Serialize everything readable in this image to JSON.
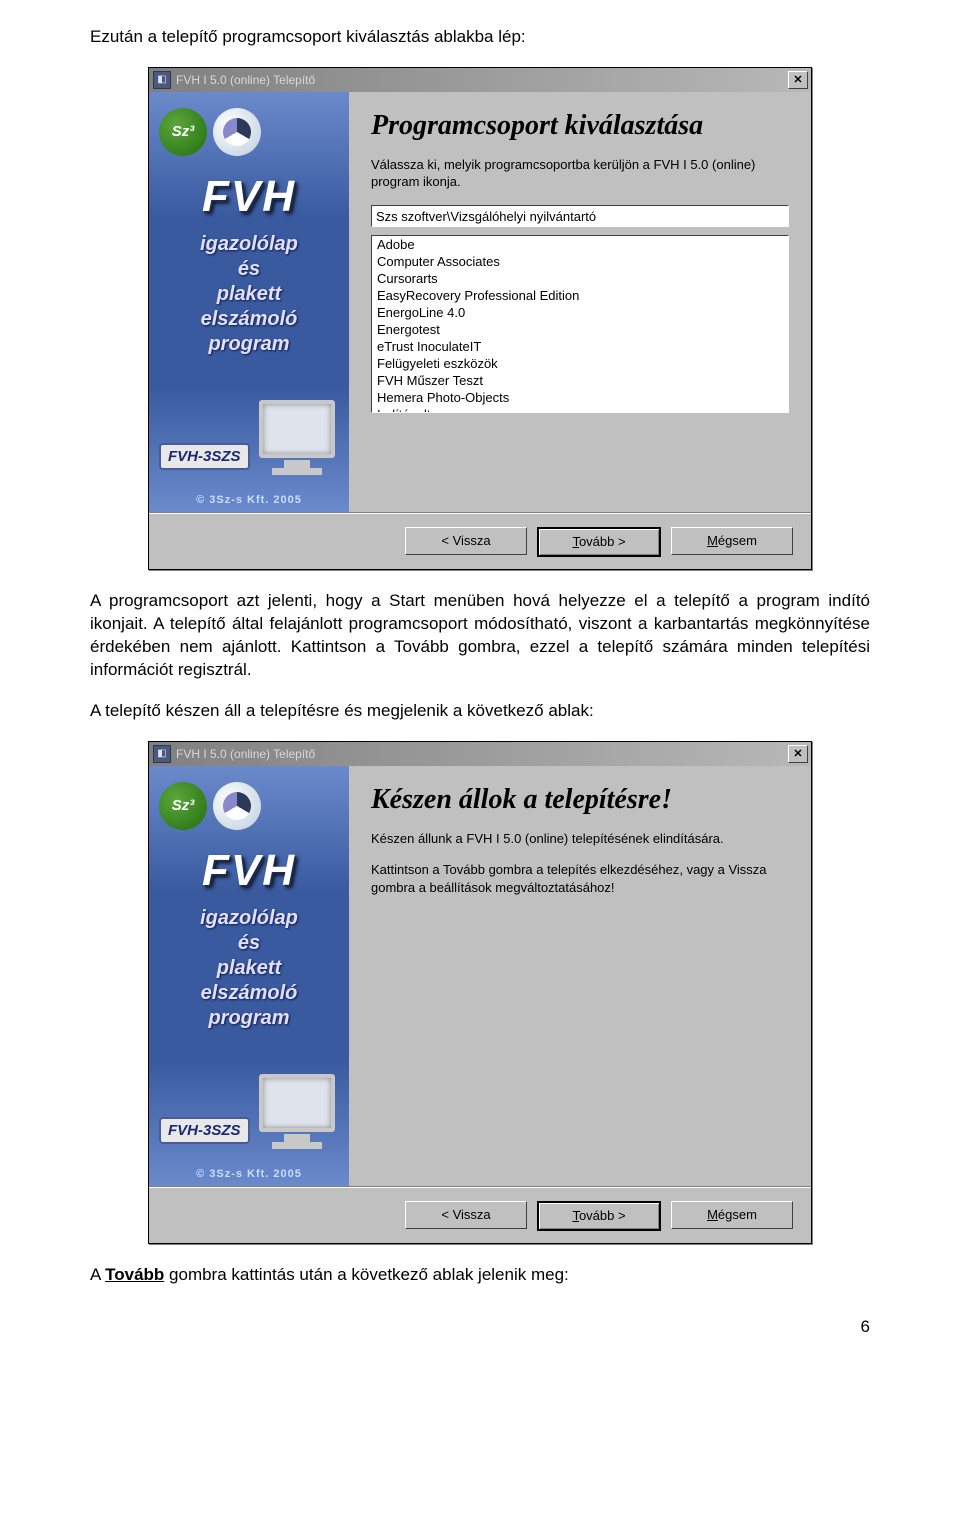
{
  "doc": {
    "intro1": "Ezután a telepítő programcsoport kiválasztás ablakba lép:",
    "para2": "A programcsoport azt jelenti, hogy a Start menüben hová helyezze el a telepítő a program indító ikonjait. A telepítő által felajánlott programcsoport módosítható, viszont a karbantartás megkönnyítése érdekében nem ajánlott. Kattintson a Tovább gombra, ezzel a telepítő számára minden telepítési információt regisztrál.",
    "para3": "A telepítő készen áll a telepítésre és megjelenik a következő ablak:",
    "para4_pre": "A ",
    "para4_bold": "Tovább",
    "para4_post": " gombra kattintás után a következő ablak jelenik meg:",
    "page_number": "6"
  },
  "installer": {
    "title": "FVH I 5.0 (online) Telepítő",
    "sidebar": {
      "brand": "FVH",
      "logo_sz3": "Sz³",
      "sub_line1": "igazolólap",
      "sub_line2": "és",
      "sub_line3": "plakett",
      "sub_line4": "elszámoló",
      "sub_line5": "program",
      "tag": "FVH-3SZS",
      "footer": "© 3Sz-s Kft.   2005"
    },
    "buttons": {
      "back": "< Vissza",
      "next_prefix": "T",
      "next_rest": "ovább >",
      "cancel_prefix": "M",
      "cancel_rest": "égsem"
    }
  },
  "win1": {
    "heading": "Programcsoport kiválasztása",
    "desc": "Válassza ki, melyik programcsoportba kerüljön a FVH I 5.0 (online) program ikonja.",
    "input_value": "Szs szoftver\\Vizsgálóhelyi nyilvántartó",
    "list_items": [
      "Adobe",
      "Computer Associates",
      "Cursorarts",
      "EasyRecovery Professional Edition",
      "EnergoLine 4.0",
      "Energotest",
      "eTrust InoculateIT",
      "Felügyeleti eszközök",
      "FVH Műszer Teszt",
      "Hemera Photo-Objects",
      "Indítópult"
    ]
  },
  "win2": {
    "heading": "Készen állok a telepítésre!",
    "desc1": "Készen állunk a FVH I 5.0 (online) telepítésének elindítására.",
    "desc2": "Kattintson a Tovább gombra a telepítés elkezdéséhez, vagy a Vissza gombra a beállítások megváltoztatásához!"
  }
}
